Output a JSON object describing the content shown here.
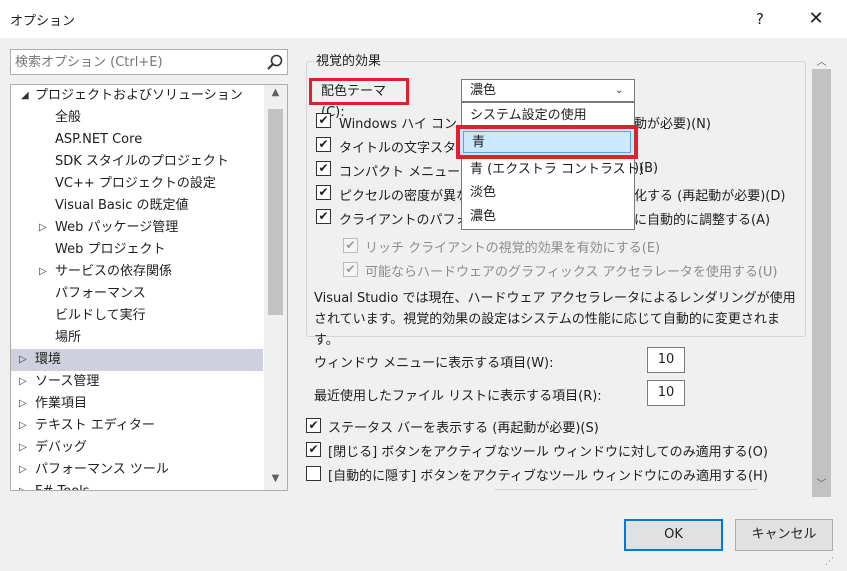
{
  "window": {
    "title": "オプション",
    "help": "?",
    "close": "✕"
  },
  "search": {
    "placeholder": "検索オプション (Ctrl+E)"
  },
  "tree": {
    "items": [
      {
        "label": "プロジェクトおよびソリューション",
        "arrow": "◢"
      },
      {
        "label": "全般"
      },
      {
        "label": "ASP.NET Core"
      },
      {
        "label": "SDK スタイルのプロジェクト"
      },
      {
        "label": "VC++ プロジェクトの設定"
      },
      {
        "label": "Visual Basic の既定値"
      },
      {
        "label": "Web パッケージ管理",
        "arrow": "▷"
      },
      {
        "label": "Web プロジェクト"
      },
      {
        "label": "サービスの依存関係",
        "arrow": "▷"
      },
      {
        "label": "パフォーマンス"
      },
      {
        "label": "ビルドして実行"
      },
      {
        "label": "場所"
      },
      {
        "label": "環境",
        "arrow": "▷"
      },
      {
        "label": "ソース管理",
        "arrow": "▷"
      },
      {
        "label": "作業項目",
        "arrow": "▷"
      },
      {
        "label": "テキスト エディター",
        "arrow": "▷"
      },
      {
        "label": "デバッグ",
        "arrow": "▷"
      },
      {
        "label": "パフォーマンス ツール",
        "arrow": "▷"
      },
      {
        "label": "F# Tools",
        "arrow": "▷"
      }
    ],
    "selected": "環境"
  },
  "visual_effects": {
    "group_label": "視覚的効果",
    "theme_label": "配色テーマ(C):",
    "theme_value": "濃色",
    "dropdown_options": [
      "システム設定の使用",
      "青",
      "青 (エクストラ コントラスト)",
      "淡色",
      "濃色"
    ],
    "highlighted_option": "青",
    "checkboxes": [
      {
        "label": "Windows ハイ コント",
        "suffix": "動が必要)(N)",
        "checked": "✔"
      },
      {
        "label": "タイトルの文字スタイ",
        "suffix": "",
        "checked": "✔"
      },
      {
        "label": "コンパクト メニューと検",
        "suffix": ")(B)",
        "checked": "✔"
      },
      {
        "label": "ピクセルの密度が異な",
        "suffix": "化する (再起動が必要)(D)",
        "checked": "✔"
      },
      {
        "label": "クライアントのパフォーマ",
        "suffix": "に自動的に調整する(A)",
        "checked": "✔"
      }
    ],
    "sub_checkboxes": [
      {
        "label": "リッチ クライアントの視覚的効果を有効にする(E)",
        "checked": "✔"
      },
      {
        "label": "可能ならハードウェアのグラフィックス アクセラレータを使用する(U)",
        "checked": "✔"
      }
    ],
    "info": "Visual Studio では現在、ハードウェア アクセラレータによるレンダリングが使用されています。視覚的効果の設定はシステムの性能に応じて自動的に変更されます。"
  },
  "window_menu": {
    "label": "ウィンドウ メニューに表示する項目(W):",
    "value": "10"
  },
  "recent_files": {
    "label": "最近使用したファイル リストに表示する項目(R):",
    "value": "10"
  },
  "bottom_checkboxes": [
    {
      "label": "ステータス バーを表示する (再起動が必要)(S)",
      "checked": "✔"
    },
    {
      "label": "[閉じる] ボタンをアクティブなツール ウィンドウに対してのみ適用する(O)",
      "checked": "✔"
    },
    {
      "label": "[自動的に隠す] ボタンをアクティブなツール ウィンドウにのみ適用する(H)",
      "checked": ""
    }
  ],
  "buttons": {
    "ok": "OK",
    "cancel": "キャンセル"
  },
  "colors": {
    "highlight_border": "#e0202c",
    "selection": "#cce8ff",
    "accent": "#0078d7"
  }
}
